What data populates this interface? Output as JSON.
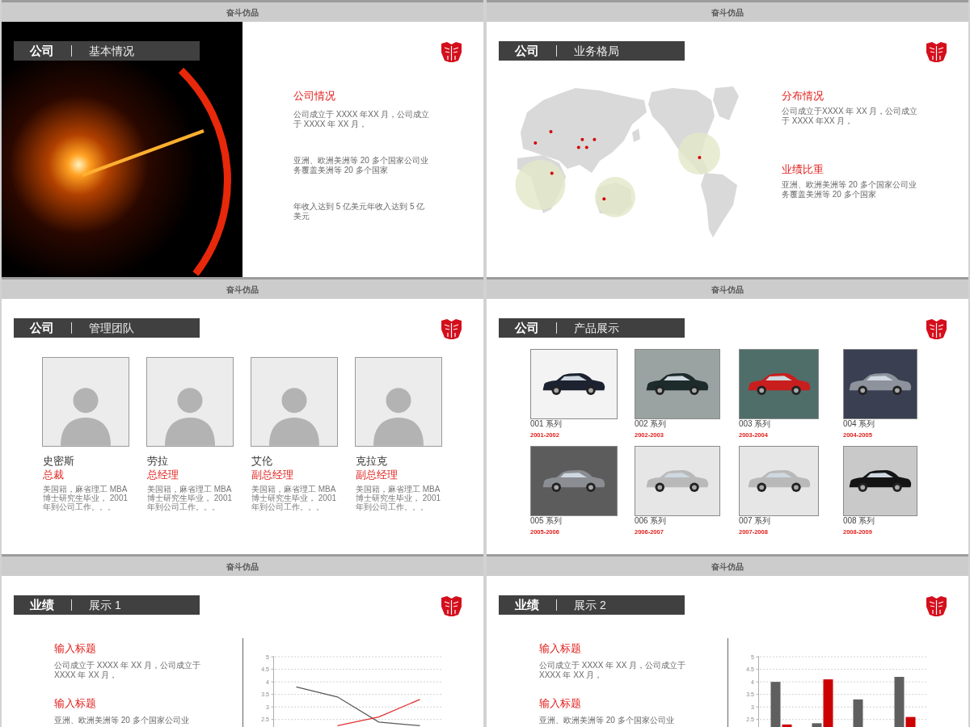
{
  "slides": [
    {
      "kind": "intro",
      "caption": "奋斗仿品",
      "title": {
        "category": "公司",
        "topic": "基本情况"
      },
      "sections": [
        {
          "heading": "公司情况",
          "text": "公司成立于 XXXX 年XX 月，公司成立于 XXXX 年 XX 月，"
        },
        {
          "text": "亚洲、欧洲美洲等 20 多个国家公司业务覆盖美洲等 20 多个国家"
        },
        {
          "text": "年收入达到 5 亿美元年收入达到 5 亿美元"
        }
      ]
    },
    {
      "kind": "map",
      "caption": "奋斗仿品",
      "title": {
        "category": "公司",
        "topic": "业务格局"
      },
      "sections": [
        {
          "heading": "分布情况",
          "text": "公司成立于XXXX 年 XX 月，公司成立于 XXXX 年XX 月，"
        },
        {
          "heading": "业绩比重",
          "text": "亚洲、欧洲美洲等 20 多个国家公司业务覆盖美洲等 20 多个国家"
        }
      ]
    },
    {
      "kind": "team",
      "caption": "奋斗仿品",
      "title": {
        "category": "公司",
        "topic": "管理团队"
      },
      "members": [
        {
          "name": "史密斯",
          "role": "总裁",
          "bio": "美国籍，麻省理工 MBA 博士研究生毕业， 2001 年到公司工作。。。"
        },
        {
          "name": "劳拉",
          "role": "总经理",
          "bio": "美国籍，麻省理工 MBA 博士研究生毕业， 2001 年到公司工作。。。"
        },
        {
          "name": "艾伦",
          "role": "副总经理",
          "bio": "美国籍，麻省理工 MBA 博士研究生毕业， 2001 年到公司工作。。。"
        },
        {
          "name": "克拉克",
          "role": "副总经理",
          "bio": "美国籍，麻省理工 MBA 博士研究生毕业， 2001 年到公司工作。。。"
        }
      ]
    },
    {
      "kind": "products",
      "caption": "奋斗仿品",
      "title": {
        "category": "公司",
        "topic": "产品展示"
      },
      "products": [
        {
          "name": "001 系列",
          "years": "2001-2002"
        },
        {
          "name": "002 系列",
          "years": "2002-2003"
        },
        {
          "name": "003 系列",
          "years": "2003-2004"
        },
        {
          "name": "004 系列",
          "years": "2004-2005"
        },
        {
          "name": "005 系列",
          "years": "2005-2006"
        },
        {
          "name": "006 系列",
          "years": "2006-2007"
        },
        {
          "name": "007 系列",
          "years": "2007-2008"
        },
        {
          "name": "008 系列",
          "years": "2008-2009"
        }
      ]
    },
    {
      "kind": "chart",
      "caption": "奋斗仿品",
      "title": {
        "category": "业绩",
        "topic": "展示 1"
      },
      "sections": [
        {
          "heading": "输入标题",
          "text": "公司成立于 XXXX 年 XX 月，公司成立于XXXX 年 XX 月，"
        },
        {
          "heading": "输入标题",
          "text": "亚洲、欧洲美洲等 20 多个国家公司业"
        }
      ],
      "chart_data": {
        "type": "line",
        "ylim": [
          2.2,
          5
        ],
        "yticks": [
          2.5,
          3,
          3.5,
          4,
          4.5,
          5
        ],
        "grid": true,
        "series": [
          {
            "color": "#595959",
            "values": [
              3.8,
              3.4,
              2.4,
              2.25
            ]
          },
          {
            "color": "#e03030",
            "values": [
              null,
              2.25,
              2.6,
              3.3
            ]
          }
        ]
      }
    },
    {
      "kind": "chart",
      "caption": "奋斗仿品",
      "title": {
        "category": "业绩",
        "topic": "展示 2"
      },
      "sections": [
        {
          "heading": "输入标题",
          "text": "公司成立于 XXXX 年 XX 月，公司成立于XXXX 年 XX 月，"
        },
        {
          "heading": "输入标题",
          "text": "亚洲、欧洲美洲等 20 多个国家公司业"
        }
      ],
      "chart_data": {
        "type": "bar",
        "ylim": [
          2.2,
          5
        ],
        "yticks": [
          2.5,
          3,
          3.5,
          4,
          4.5,
          5
        ],
        "grid": true,
        "series": [
          {
            "color": "#5f5f5f",
            "values": [
              4.0,
              2.35,
              3.3,
              4.2
            ]
          },
          {
            "color": "#cc0000",
            "values": [
              2.3,
              4.1,
              null,
              2.6
            ]
          }
        ]
      }
    }
  ]
}
